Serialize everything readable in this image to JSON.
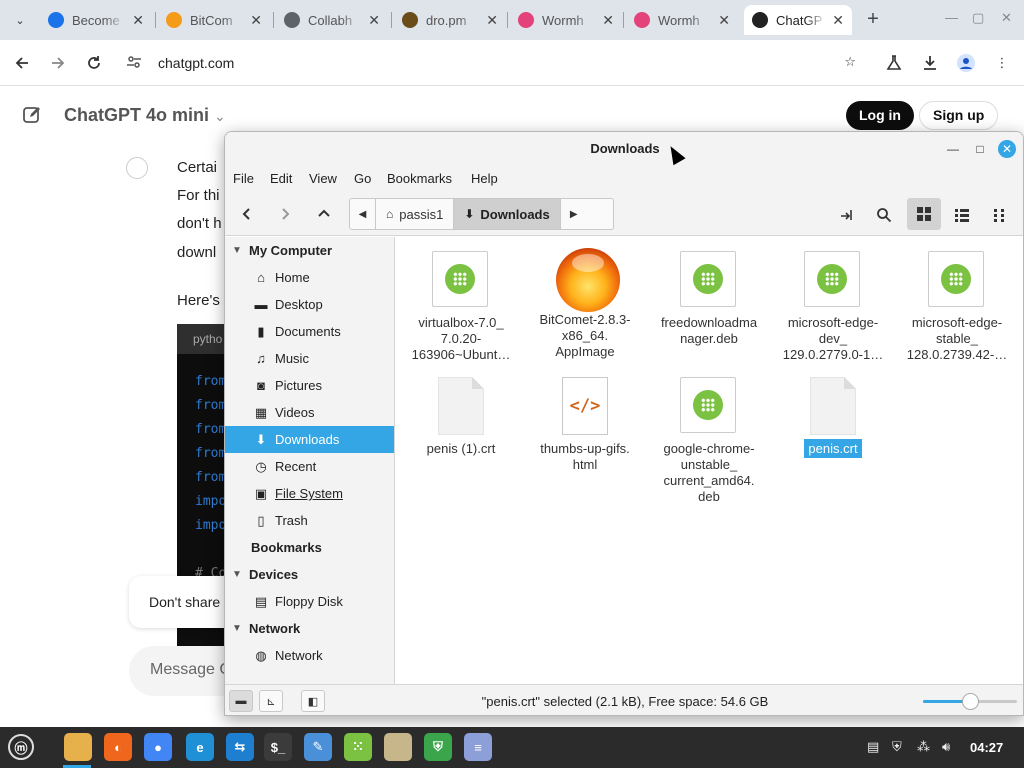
{
  "browser": {
    "tabs": [
      {
        "title": "Become",
        "color": "#1a73e8"
      },
      {
        "title": "BitCom",
        "color": "#f59b1a"
      },
      {
        "title": "Collabh",
        "color": "#5f6368"
      },
      {
        "title": "dro.pm",
        "color": "#6b4b1a"
      },
      {
        "title": "Wormh",
        "color": "#e3427a"
      },
      {
        "title": "Wormh",
        "color": "#e3427a"
      },
      {
        "title": "ChatGP",
        "color": "#222222"
      }
    ],
    "url": "chatgpt.com"
  },
  "chat": {
    "title": "ChatGPT 4o mini",
    "login": "Log in",
    "signup": "Sign up",
    "lines": [
      "Certai",
      "For thi",
      "don't h",
      "downl"
    ],
    "heres": "Here's",
    "code_lang": "pytho",
    "code_keywords": [
      "from",
      "from",
      "from",
      "from",
      "from",
      "impo",
      "impo"
    ],
    "code_comment": "# Co",
    "toast": "Don't share",
    "message_placeholder": "Message C"
  },
  "file_manager": {
    "title": "Downloads",
    "menu": [
      "File",
      "Edit",
      "View",
      "Go",
      "Bookmarks",
      "Help"
    ],
    "breadcrumbs": [
      "passis1",
      "Downloads"
    ],
    "sidebar": {
      "my_computer": "My Computer",
      "items": [
        {
          "label": "Home",
          "icon": "home-icon",
          "glyph": "⌂"
        },
        {
          "label": "Desktop",
          "icon": "desktop-icon",
          "glyph": "▬"
        },
        {
          "label": "Documents",
          "icon": "documents-icon",
          "glyph": "▮"
        },
        {
          "label": "Music",
          "icon": "music-icon",
          "glyph": "♫"
        },
        {
          "label": "Pictures",
          "icon": "pictures-icon",
          "glyph": "◙"
        },
        {
          "label": "Videos",
          "icon": "videos-icon",
          "glyph": "▦"
        },
        {
          "label": "Downloads",
          "icon": "download-icon",
          "glyph": "⬇"
        },
        {
          "label": "Recent",
          "icon": "recent-icon",
          "glyph": "◷"
        },
        {
          "label": "File System",
          "icon": "filesystem-icon",
          "glyph": "▣"
        },
        {
          "label": "Trash",
          "icon": "trash-icon",
          "glyph": "▯"
        }
      ],
      "bookmarks": "Bookmarks",
      "devices": "Devices",
      "device_items": [
        {
          "label": "Floppy Disk",
          "icon": "floppy-icon",
          "glyph": "▤"
        }
      ],
      "network": "Network",
      "network_items": [
        {
          "label": "Network",
          "icon": "network-icon",
          "glyph": "◍"
        }
      ]
    },
    "files": [
      {
        "name": "virtualbox-7.0_\n7.0.20-\n163906~Ubunt…",
        "type": "package"
      },
      {
        "name": "BitComet-2.8.3-\nx86_64.\nAppImage",
        "type": "bitcomet"
      },
      {
        "name": "freedownloadma\nnager.deb",
        "type": "package"
      },
      {
        "name": "microsoft-edge-\ndev_\n129.0.2779.0-1…",
        "type": "package"
      },
      {
        "name": "microsoft-edge-\nstable_\n128.0.2739.42-…",
        "type": "package"
      },
      {
        "name": "penis (1).crt",
        "type": "document"
      },
      {
        "name": "thumbs-up-gifs.\nhtml",
        "type": "html"
      },
      {
        "name": "google-chrome-\nunstable_\ncurrent_amd64.\ndeb",
        "type": "package"
      },
      {
        "name": "penis.crt",
        "type": "document",
        "selected": true
      }
    ],
    "status": "\"penis.crt\" selected (2.1 kB), Free space: 54.6 GB",
    "zoom_level": 0.5
  },
  "taskbar": {
    "clock": "04:27",
    "apps": [
      {
        "name": "menu-icon",
        "color": "#2b2b2b",
        "glyph": "ⓜ"
      },
      {
        "name": "files-icon",
        "color": "#e6b04a",
        "glyph": ""
      },
      {
        "name": "firefox-icon",
        "color": "#f0661c",
        "glyph": "◐"
      },
      {
        "name": "chrome-icon",
        "color": "#4285f4",
        "glyph": "●"
      },
      {
        "name": "edge-dev-icon",
        "color": "#1f8fd6",
        "glyph": "e"
      },
      {
        "name": "transfer-icon",
        "color": "#1e7fd0",
        "glyph": "⇆"
      },
      {
        "name": "terminal-icon",
        "color": "#3b3b3b",
        "glyph": "$_"
      },
      {
        "name": "text-editor-icon",
        "color": "#4a90d9",
        "glyph": "✎"
      },
      {
        "name": "package-icon",
        "color": "#7bc142",
        "glyph": "⁙"
      },
      {
        "name": "folder-icon",
        "color": "#c7b68a",
        "glyph": ""
      },
      {
        "name": "shield-icon",
        "color": "#3aa54a",
        "glyph": "⛨"
      },
      {
        "name": "notes-icon",
        "color": "#8c9fd9",
        "glyph": "≡"
      }
    ]
  }
}
